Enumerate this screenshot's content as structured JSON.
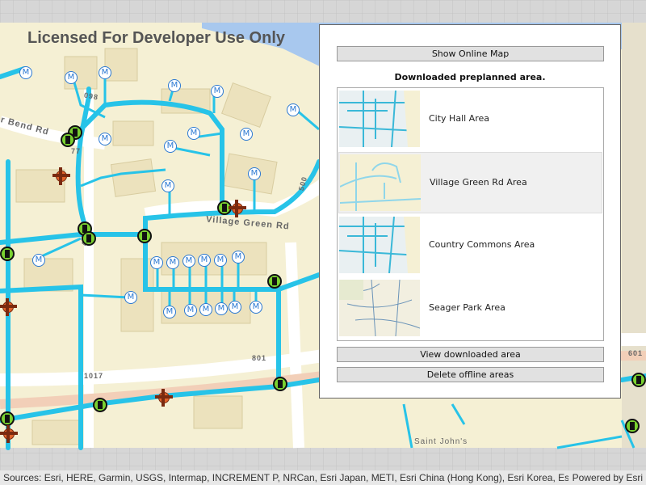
{
  "map": {
    "watermark": "Licensed For Developer Use Only",
    "road_labels": {
      "village_green": "Village Green Rd",
      "bend": "r Bend Rd",
      "r493": "493",
      "r801": "801",
      "r1017": "1017",
      "r601": "601",
      "r500": "500",
      "saint_johns": "Saint John's",
      "r098": "098",
      "r77": "77"
    },
    "colors": {
      "pipe": "#27c3e8",
      "parcel": "#f7f0cf",
      "building": "#efe6c2",
      "water": "#a8c8ee",
      "road": "#ffffff",
      "hydrant": "#e2632b",
      "valve": "#7ad130"
    }
  },
  "panel": {
    "show_online_button": "Show Online Map",
    "title": "Downloaded preplanned area.",
    "areas": [
      {
        "label": "City Hall Area",
        "selected": false
      },
      {
        "label": "Village Green Rd Area",
        "selected": true
      },
      {
        "label": "Country Commons Area",
        "selected": false
      },
      {
        "label": "Seager Park Area",
        "selected": false
      }
    ],
    "view_button": "View downloaded area",
    "delete_button": "Delete offline areas"
  },
  "attribution": {
    "sources": "Sources: Esri, HERE, Garmin, USGS, Intermap, INCREMENT P, NRCan, Esri Japan, METI, Esri China (Hong Kong), Esri Korea, Esri (Thail...",
    "powered": "Powered by Esri"
  }
}
